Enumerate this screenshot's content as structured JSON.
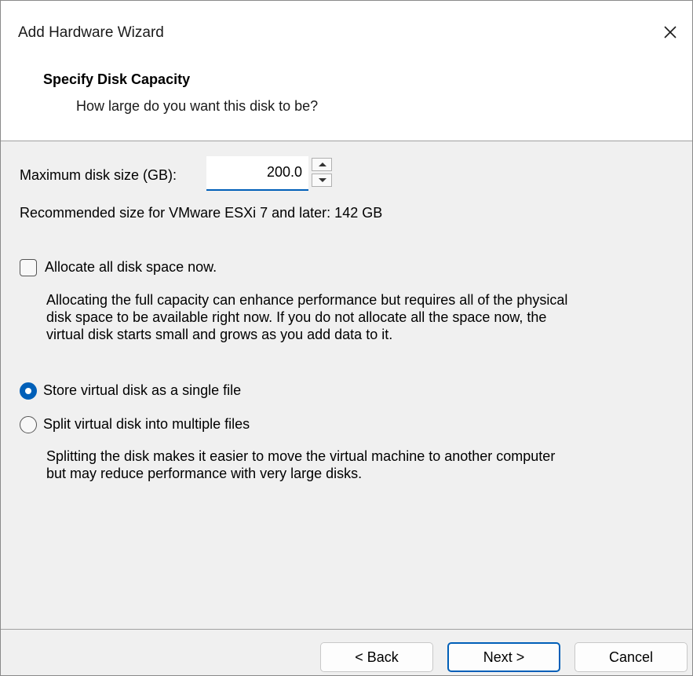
{
  "window": {
    "title": "Add Hardware Wizard"
  },
  "header": {
    "title": "Specify Disk Capacity",
    "subtitle": "How large do you want this disk to be?"
  },
  "disk_size": {
    "label": "Maximum disk size (GB):",
    "value": "200.0",
    "recommended": "Recommended size for VMware ESXi 7 and later: 142 GB"
  },
  "allocate": {
    "label": "Allocate all disk space now.",
    "checked": false,
    "description_lines": [
      "Allocating the full capacity can enhance performance but requires all of the physical",
      "disk space to be available right now. If you do not allocate all the space now, the",
      "virtual disk starts small and grows as you add data to it."
    ]
  },
  "storage_options": {
    "selected": "single",
    "single_label": "Store virtual disk as a single file",
    "split_label": "Split virtual disk into multiple files",
    "split_description_lines": [
      "Splitting the disk makes it easier to move the virtual machine to another computer",
      "but may reduce performance with very large disks."
    ]
  },
  "buttons": {
    "back": "< Back",
    "next": "Next >",
    "cancel": "Cancel"
  },
  "colors": {
    "accent": "#005fb8",
    "content_bg": "#f0f0f0"
  },
  "icons": {
    "close": "close-icon",
    "spin_up": "chevron-up-icon",
    "spin_down": "chevron-down-icon"
  }
}
